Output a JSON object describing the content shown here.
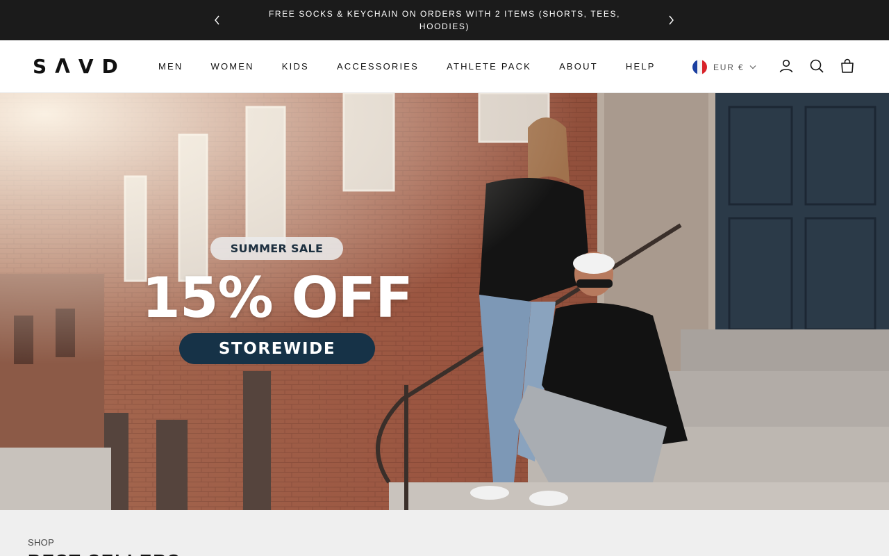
{
  "announcement": {
    "text": "FREE SOCKS & KEYCHAIN ON ORDERS WITH 2 ITEMS (SHORTS, TEES, HOODIES)",
    "prev_icon": "chevron-left-icon",
    "next_icon": "chevron-right-icon"
  },
  "header": {
    "logo": "SΛVD",
    "nav": [
      "MEN",
      "WOMEN",
      "KIDS",
      "ACCESSORIES",
      "ATHLETE PACK",
      "ABOUT",
      "HELP"
    ],
    "currency": "EUR €",
    "icons": {
      "account": "account-icon",
      "search": "search-icon",
      "cart": "cart-icon"
    }
  },
  "hero": {
    "badge": "SUMMER SALE",
    "headline": "15% OFF",
    "subline": "STOREWIDE",
    "accent_color": "#163247"
  },
  "shop": {
    "eyebrow": "SHOP",
    "heading": "BEST SELLERS"
  }
}
